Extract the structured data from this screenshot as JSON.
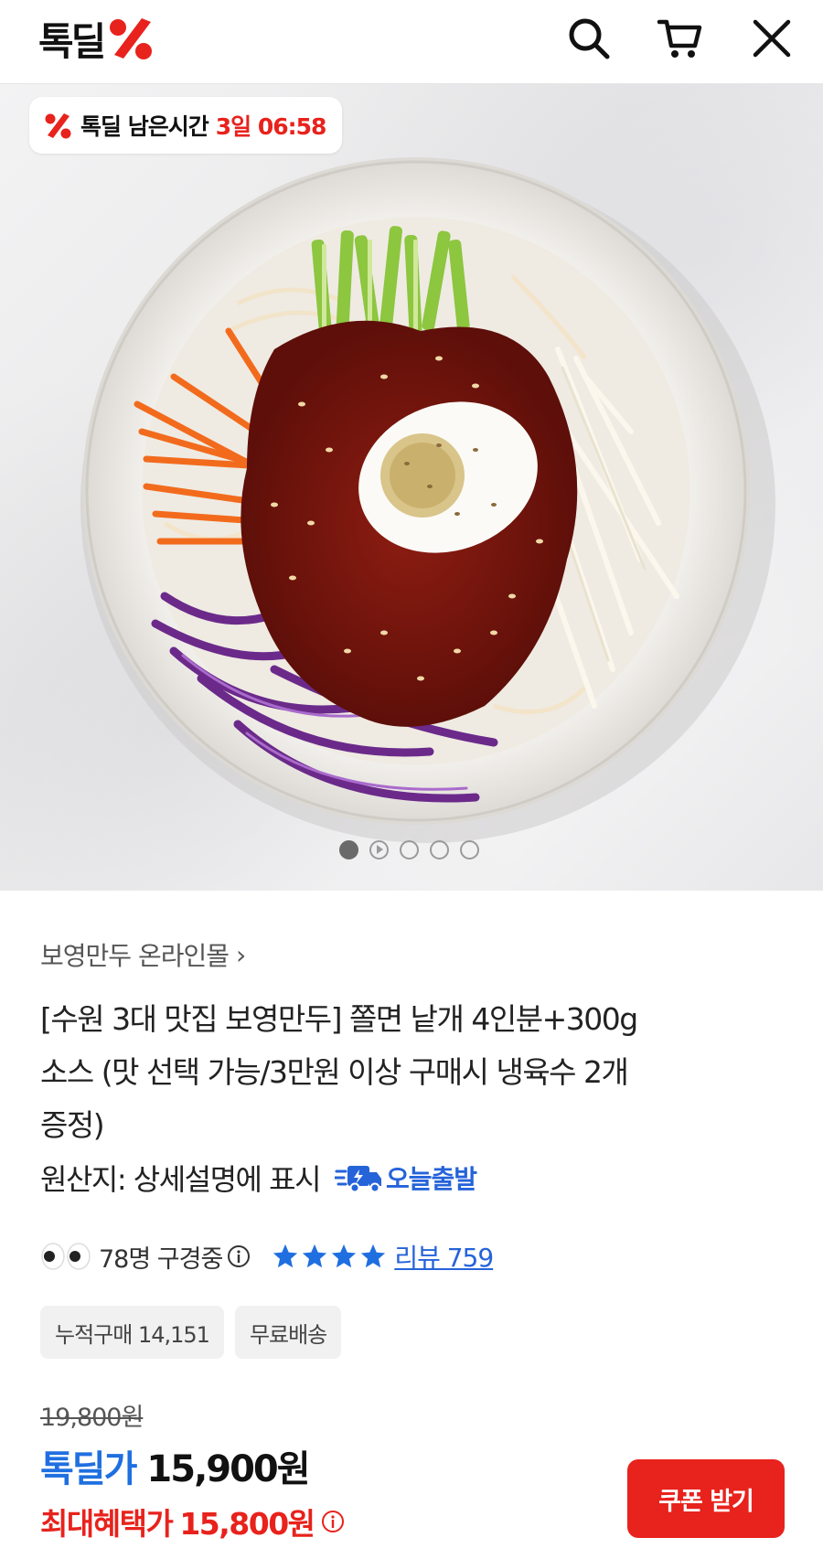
{
  "header": {
    "logo_text": "톡딜",
    "icons": [
      "search-icon",
      "cart-icon",
      "close-icon"
    ]
  },
  "hero": {
    "timer_label": "톡딜 남은시간",
    "timer_value": "3일 06:58",
    "carousel_count": 5,
    "carousel_active": 0
  },
  "product": {
    "seller": "보영만두 온라인몰",
    "title_lines": [
      "[수원 3대 맛집 보영만두] 쫄면 낱개 4인분+300g",
      "소스 (맛 선택 가능/3만원 이상 구매시 냉육수 2개",
      "증정)"
    ],
    "origin": "원산지: 상세설명에 표시",
    "shipping_badge": "오늘출발",
    "viewers": "78명 구경중",
    "rating_stars": 4,
    "review": "리뷰 759",
    "chips": [
      "누적구매 14,151",
      "무료배송"
    ],
    "original_price": "19,800원",
    "sale_label": "톡딜가",
    "sale_price": "15,900원",
    "max_benefit_label": "최대혜택가",
    "max_benefit_price": "15,800원",
    "coupon_button": "쿠폰 받기"
  },
  "colors": {
    "brand_red": "#e8221c",
    "link_blue": "#2563d9",
    "sale_blue": "#1f6fe0"
  }
}
